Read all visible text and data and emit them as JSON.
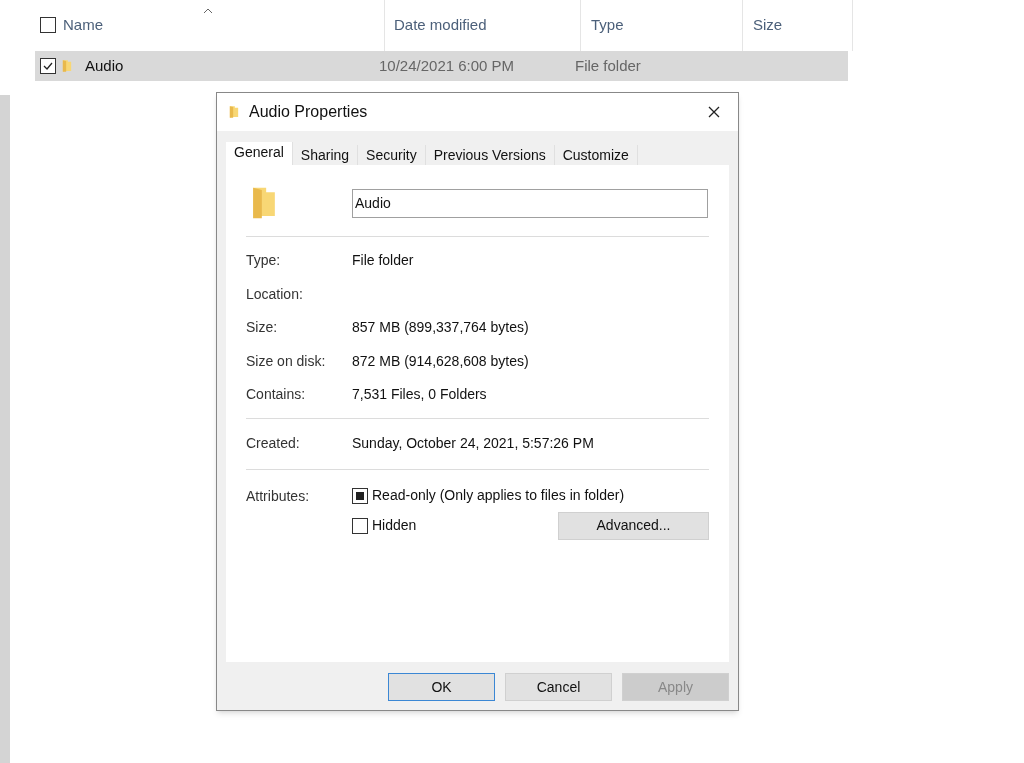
{
  "explorer": {
    "select_all_checked": false,
    "columns": [
      "Name",
      "Date modified",
      "Type",
      "Size"
    ],
    "rows": [
      {
        "name": "Audio",
        "date": "10/24/2021 6:00 PM",
        "type": "File folder",
        "selected": true,
        "checked": true
      }
    ]
  },
  "dialog": {
    "title": "Audio Properties",
    "tabs": [
      {
        "label": "General",
        "selected": true
      },
      {
        "label": "Sharing",
        "selected": false
      },
      {
        "label": "Security",
        "selected": false
      },
      {
        "label": "Previous Versions",
        "selected": false
      },
      {
        "label": "Customize",
        "selected": false
      }
    ],
    "name_value": "Audio",
    "groups": [
      [
        {
          "label": "Type:",
          "value": "File folder"
        },
        {
          "label": "Location:"
        },
        {
          "label": "Size:",
          "value": "857 MB (899,337,764 bytes)"
        },
        {
          "label": "Size on disk:",
          "value": "872 MB (914,628,608 bytes)"
        },
        {
          "label": "Contains:",
          "value": "7,531 Files, 0 Folders"
        }
      ],
      [
        {
          "label": "Created:",
          "value": "Sunday, October 24, 2021, 5:57:26 PM"
        }
      ]
    ],
    "attributes_label": "Attributes:",
    "attributes": [
      {
        "label": "Read-only (Only applies to files in folder)",
        "checked": true,
        "indeterminate": true
      },
      {
        "label": "Hidden",
        "checked": false,
        "indeterminate": false
      }
    ],
    "advanced_button": "Advanced...",
    "buttons": [
      {
        "label": "OK",
        "kind": "default",
        "disabled": false
      },
      {
        "label": "Cancel",
        "kind": "normal",
        "disabled": false
      },
      {
        "label": "Apply",
        "kind": "normal",
        "disabled": true
      }
    ]
  }
}
